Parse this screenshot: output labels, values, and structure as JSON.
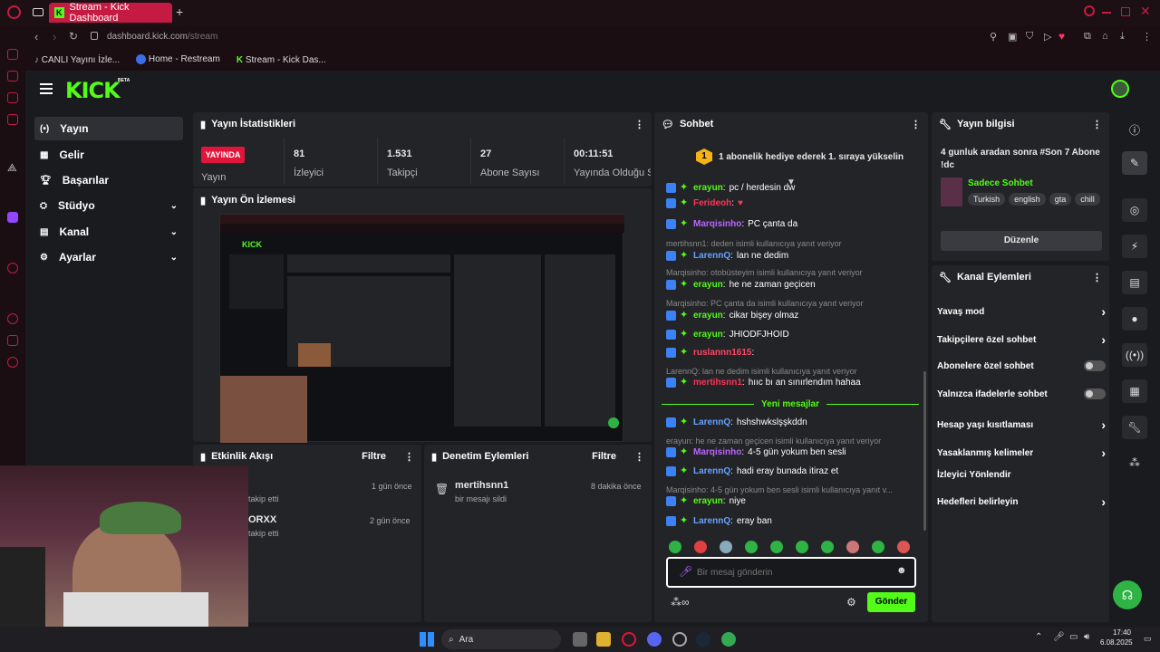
{
  "browser": {
    "tab_title": "Stream - Kick Dashboard",
    "url_host": "dashboard.kick.com",
    "url_path": "/stream",
    "bookmarks": [
      "CANLI Yayını İzle...",
      "Home - Restream",
      "Stream - Kick Das..."
    ]
  },
  "brand": {
    "logo": "KICK",
    "beta": "BETA",
    "accent": "#53fc18"
  },
  "nav": [
    {
      "label": "Yayın",
      "icon": "broadcast-icon"
    },
    {
      "label": "Gelir",
      "icon": "revenue-icon"
    },
    {
      "label": "Başarılar",
      "icon": "trophy-icon"
    },
    {
      "label": "Stüdyo",
      "icon": "studio-icon"
    },
    {
      "label": "Kanal",
      "icon": "channel-icon"
    },
    {
      "label": "Ayarlar",
      "icon": "gear-icon"
    }
  ],
  "stats": {
    "title": "Yayın İstatistikleri",
    "live_badge": "YAYINDA",
    "live_label": "Yayın",
    "items": [
      {
        "value": "81",
        "label": "İzleyici"
      },
      {
        "value": "1.531",
        "label": "Takipçi"
      },
      {
        "value": "27",
        "label": "Abone Sayısı"
      },
      {
        "value": "00:11:51",
        "label": "Yayında Olduğu Süre"
      }
    ]
  },
  "preview": {
    "title": "Yayın Ön İzlemesi"
  },
  "activity": {
    "title": "Etkinlik Akışı",
    "filter": "Filtre",
    "items": [
      {
        "name": "",
        "action": "takip etti",
        "time": "1 gün önce"
      },
      {
        "name": "ORXX",
        "action": "takip etti",
        "time": "2 gün önce"
      }
    ]
  },
  "moderation": {
    "title": "Denetim Eylemleri",
    "filter": "Filtre",
    "items": [
      {
        "name": "mertihsnn1",
        "action": "bir mesajı sildi",
        "time": "8 dakika önce"
      }
    ]
  },
  "chat": {
    "title": "Sohbet",
    "gift_num": "1",
    "gift_text": "1 abonelik hediye ederek 1. sıraya yükselin",
    "new_messages": "Yeni mesajlar",
    "placeholder": "Bir mesaj gönderin",
    "send": "Gönder",
    "messages": [
      {
        "type": "msg",
        "user": "erayun",
        "text": "pc / herdesin dw",
        "color": "#53fc18"
      },
      {
        "type": "msg",
        "user": "Ferideoh",
        "text": "♥",
        "color": "#ff3355"
      },
      {
        "type": "msg",
        "user": "Marqisinho",
        "text": "PC çanta da",
        "color": "#bb66ff"
      },
      {
        "type": "reply",
        "text": "mertihsnn1: deden isimli kullanıcıya yanıt veriyor"
      },
      {
        "type": "msg",
        "user": "LarennQ",
        "text": "lan ne dedim",
        "color": "#66a3ff"
      },
      {
        "type": "reply",
        "text": "Marqisinho: otobüsteyim isimli kullanıcıya yanıt veriyor"
      },
      {
        "type": "msg",
        "user": "erayun",
        "text": "he ne zaman geçicen",
        "color": "#53fc18"
      },
      {
        "type": "reply",
        "text": "Marqisinho: PC çanta da isimli kullanıcıya yanıt veriyor"
      },
      {
        "type": "msg",
        "user": "erayun",
        "text": "cikar bişey olmaz",
        "color": "#53fc18"
      },
      {
        "type": "msg",
        "user": "erayun",
        "text": "JHIODFJHOID",
        "color": "#53fc18"
      },
      {
        "type": "msg",
        "user": "ruslannn1615",
        "text": "",
        "color": "#ff4466"
      },
      {
        "type": "reply",
        "text": "LarennQ: lan ne dedim isimli kullanıcıya yanıt veriyor"
      },
      {
        "type": "msg",
        "user": "mertihsnn1",
        "text": "hııc bı an sınırlendım hahaa",
        "color": "#ff3355"
      },
      {
        "type": "msg",
        "user": "LarennQ",
        "text": "hshshwkslşşkddn",
        "color": "#66a3ff"
      },
      {
        "type": "reply",
        "text": "erayun: he ne zaman geçicen isimli kullanıcıya yanıt veriyor"
      },
      {
        "type": "msg",
        "user": "Marqisinho",
        "text": "4-5 gün yokum ben sesli",
        "color": "#bb66ff"
      },
      {
        "type": "msg",
        "user": "LarennQ",
        "text": "hadi eray bunada itiraz et",
        "color": "#66a3ff"
      },
      {
        "type": "reply",
        "text": "Marqisinho: 4-5 gün yokum ben sesli isimli kullanıcıya yanıt v..."
      },
      {
        "type": "msg",
        "user": "erayun",
        "text": "niye",
        "color": "#53fc18"
      },
      {
        "type": "msg",
        "user": "LarennQ",
        "text": "eray ban",
        "color": "#66a3ff"
      }
    ]
  },
  "stream_info": {
    "title": "Yayın bilgisi",
    "stream_title": "4 gunluk aradan sonra #Son 7 Abone !dc",
    "category": "Sadece Sohbet",
    "tags": [
      "Turkish",
      "english",
      "gta",
      "chill"
    ],
    "edit": "Düzenle"
  },
  "channel_actions": {
    "title": "Kanal Eylemleri",
    "items": [
      {
        "label": "Yavaş mod",
        "control": "chevron"
      },
      {
        "label": "Takipçilere özel sohbet",
        "control": "chevron"
      },
      {
        "label": "Abonelere özel sohbet",
        "control": "toggle"
      },
      {
        "label": "Yalnızca ifadelerle sohbet",
        "control": "toggle"
      },
      {
        "label": "Hesap yaşı kısıtlaması",
        "control": "chevron"
      },
      {
        "label": "Yasaklanmış kelimeler",
        "control": "chevron"
      },
      {
        "label": "İzleyici Yönlendir",
        "control": "none"
      },
      {
        "label": "Hedefleri belirleyin",
        "control": "chevron"
      }
    ]
  },
  "taskbar": {
    "search": "Ara",
    "time": "17:40",
    "date": "6.08.2025"
  }
}
